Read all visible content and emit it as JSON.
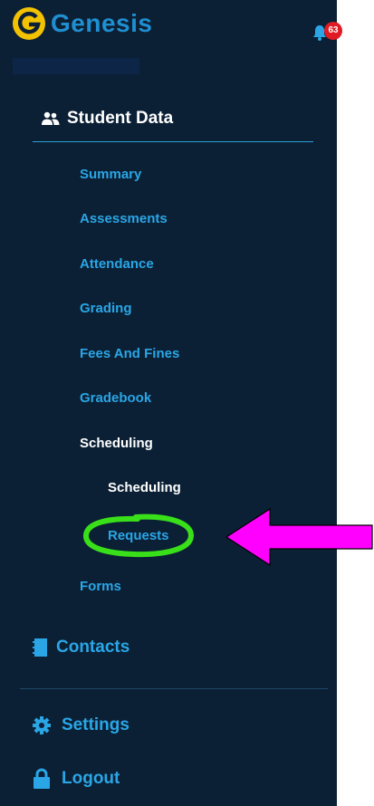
{
  "header": {
    "app_name": "Genesis",
    "notification_count": "63"
  },
  "student_data": {
    "title": "Student Data",
    "items": [
      {
        "label": "Summary"
      },
      {
        "label": "Assessments"
      },
      {
        "label": "Attendance"
      },
      {
        "label": "Grading"
      },
      {
        "label": "Fees And Fines"
      },
      {
        "label": "Gradebook"
      },
      {
        "label": "Scheduling"
      }
    ],
    "scheduling_sub": [
      {
        "label": "Scheduling"
      },
      {
        "label": "Requests"
      }
    ],
    "forms_label": "Forms"
  },
  "contacts_label": "Contacts",
  "settings_label": "Settings",
  "logout_label": "Logout",
  "colors": {
    "sidebar_bg": "#0b2035",
    "link": "#2aa6e6",
    "active": "#ffffff",
    "annotation_circle": "#39e01a",
    "annotation_arrow": "#ff00ff",
    "badge": "#e01b24",
    "logo": "#f2c200"
  }
}
